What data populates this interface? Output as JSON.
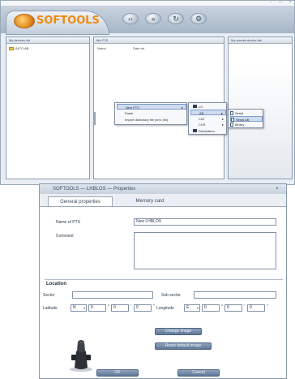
{
  "app": {
    "logo_text": "SOFTOOLS",
    "toolbar_buttons": [
      "back",
      "forward",
      "refresh",
      "settings"
    ],
    "left_pane": {
      "header": "My devices list",
      "tree_item": "ALTO AB"
    },
    "middle_pane": {
      "header": "My PTS",
      "columns": [
        "Name",
        "Date ref"
      ]
    },
    "right_pane": {
      "header": "My remote device list"
    }
  },
  "context_menu": {
    "items": [
      {
        "label": "New PTS",
        "has_submenu": true
      },
      {
        "label": "Paste",
        "has_submenu": false
      },
      {
        "label": "Import dictionary file (xml, bin)",
        "has_submenu": false
      }
    ],
    "submenu1": [
      {
        "label": "LS"
      },
      {
        "label": "AB",
        "has_submenu": true
      },
      {
        "label": "CAT",
        "has_submenu": true
      },
      {
        "label": "CHS",
        "has_submenu": true
      },
      {
        "label": "Stimulation"
      }
    ],
    "submenu2": [
      "Serial",
      "Serial AB",
      "Binary"
    ]
  },
  "dialog": {
    "title": "SOFTOOLS — LHBLOS — Properties",
    "close_label": "×",
    "tabs": [
      "General properties",
      "Memory card"
    ],
    "name_label": "Name of PTS",
    "name_value": "New LHBLOS",
    "comment_label": "Comment",
    "location_heading": "Location",
    "sector_label": "Sector",
    "subsector_label": "Sub sector",
    "latitude_label": "Latitude",
    "longitude_label": "Longitude",
    "latitude": {
      "hemisphere": "N",
      "deg": "0",
      "min": "0",
      "sec": "0"
    },
    "longitude": {
      "hemisphere": "E",
      "deg": "0",
      "min": "0",
      "sec": "0"
    },
    "change_image_button": "Change image",
    "reset_image_button": "Reset default image",
    "ok_button": "OK",
    "cancel_button": "Cancel"
  },
  "colors": {
    "logo_orange": "#f08a12",
    "button_blue": "#6f86a4",
    "frame": "#e9eef4"
  }
}
